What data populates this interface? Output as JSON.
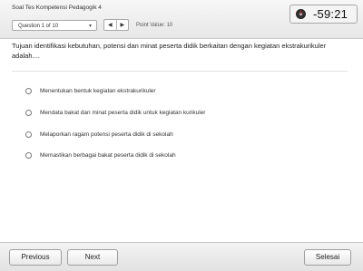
{
  "header": {
    "title": "Soal Tes Kompetensi Pedagogik 4",
    "question_selector": "Question 1 of 10",
    "point_value": "Point Value: 10",
    "timer": "-59:21"
  },
  "question": {
    "text": "Tujuan identifikasi kebutuhan, potensi dan minat peserta didik berkaitan dengan kegiatan ekstrakurikuler adalah....",
    "options": [
      "Menentukan bentuk kegiatan ekstrakurikuler",
      "Mendata bakat dan minat peserta didik untuk kegiatan kurikuler",
      "Melaporkan ragam potensi peserta didik di sekolah",
      "Memastikan berbagai bakat peserta didik di sekolah"
    ]
  },
  "footer": {
    "previous_label": "Previous",
    "next_label": "Next",
    "finish_label": "Selesai"
  },
  "icons": {
    "select_caret": "▾",
    "prev_icon": "◀",
    "next_icon": "▶"
  },
  "colors": {
    "timer_hand": "#dd2222"
  }
}
